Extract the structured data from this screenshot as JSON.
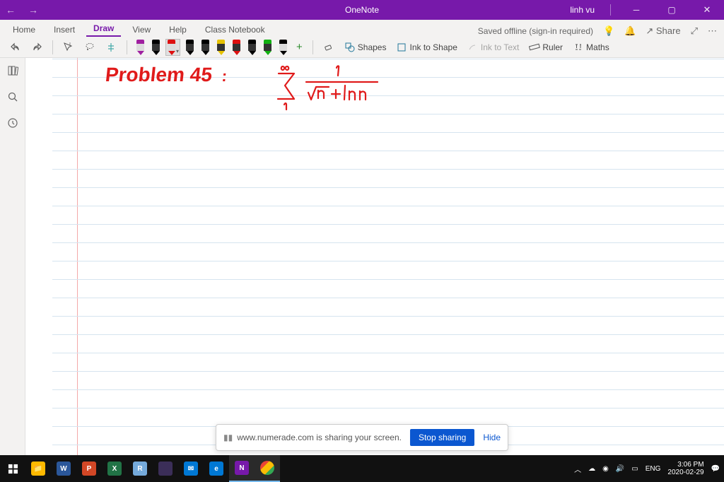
{
  "titlebar": {
    "app_title": "OneNote",
    "user": "linh vu"
  },
  "menu": {
    "tabs": [
      "Home",
      "Insert",
      "Draw",
      "View",
      "Help",
      "Class Notebook"
    ],
    "active_index": 2,
    "status_text": "Saved offline (sign-in required)",
    "share_label": "Share"
  },
  "ribbon": {
    "shapes_label": "Shapes",
    "ink_to_shape_label": "Ink to Shape",
    "ink_to_text_label": "Ink to Text",
    "ruler_label": "Ruler",
    "maths_label": "Maths",
    "pens": [
      {
        "cap": "#a020a0",
        "body": "#dcdcdc",
        "tip": "#a020a0"
      },
      {
        "cap": "#000",
        "body": "#333",
        "tip": "#000"
      },
      {
        "cap": "#d11",
        "body": "#dcdcdc",
        "tip": "#d11"
      },
      {
        "cap": "#000",
        "body": "#333",
        "tip": "#000"
      },
      {
        "cap": "#000",
        "body": "#333",
        "tip": "#000"
      },
      {
        "cap": "#e6c200",
        "body": "#333",
        "tip": "#e6c200"
      },
      {
        "cap": "#d11",
        "body": "#333",
        "tip": "#d11"
      },
      {
        "cap": "#000",
        "body": "#333",
        "tip": "#000"
      },
      {
        "cap": "#11b011",
        "body": "#333",
        "tip": "#11b011"
      },
      {
        "cap": "#000",
        "body": "#dcdcdc",
        "tip": "#000"
      }
    ],
    "selected_pen_index": 2
  },
  "canvas_ink": {
    "problem_label": "Problem 45",
    "colon": ":",
    "math_annotation": "sum from n=1 to infinity of 1 over (sqrt(n) + ln n)"
  },
  "share_notification": {
    "message": "www.numerade.com is sharing your screen.",
    "stop_label": "Stop sharing",
    "hide_label": "Hide"
  },
  "taskbar": {
    "tray": {
      "lang": "ENG",
      "time": "3:06 PM",
      "date": "2020-02-29"
    }
  }
}
